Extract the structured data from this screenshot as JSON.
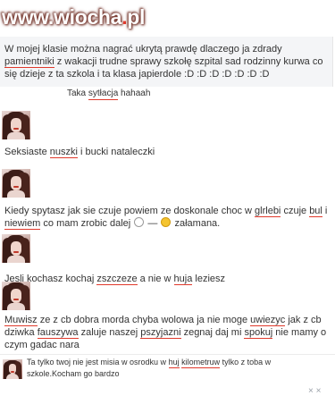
{
  "watermark": {
    "prefix": "www.",
    "brand": "wiocha",
    "dot": ".",
    "suffix": "pl"
  },
  "messages": [
    {
      "text_a": "W mojej klasie można nagrać ukrytą prawdę dlaczego ja zdrady ",
      "sp_a": "pamientniki",
      "text_b": " z wakacji trudne sprawy szkołę szpital sad rodzinny kurwa co się dzieje z ta szkola i ta klasa japierdole :D :D :D :D :D :D :D"
    },
    {
      "text_a": "Taka ",
      "sp_a": "sytłacja",
      "text_b": " hahaah"
    },
    {
      "text_a": "Seksiaste ",
      "sp_a": "nuszki",
      "text_b": " i bucki nataleczki"
    },
    {
      "text_a": "Kiedy spytasz jak sie czuje powiem ze doskonale choc w ",
      "sp_a": "glrlebi",
      "text_b": " czuje ",
      "sp_b": "bul",
      "text_c": " i ",
      "sp_c": "niewiem",
      "text_d": " co mam zrobic dalej ",
      "dash": " — ",
      "text_e": " załamana."
    },
    {
      "text_a": "Jesli kochasz kochaj ",
      "sp_a": "zszczeze",
      "text_b": " a nie w ",
      "sp_b": "huja",
      "text_c": " leziesz"
    },
    {
      "text_a": "Muwisz",
      "text_b": " ze z cb dobra morda chyba wolowa ja nie moge ",
      "sp_b": "uwiezyc",
      "text_c": " jak z cb dziwka ",
      "sp_c": "fauszywa",
      "text_d": " zaluje naszej ",
      "sp_d": "pszyjazni",
      "text_e": " zegnaj daj mi ",
      "sp_e": "spokuj",
      "text_f": " nie mamy o czym gadac nara"
    },
    {
      "text_a": "Ta tylko twoj nie jest misia w osrodku w ",
      "sp_a": "huj",
      "text_b": " ",
      "sp_b": "kilometruw",
      "text_c": " tylko z toba w szkole.Kocham go bardzo"
    }
  ],
  "footer": {
    "close": "× ×"
  },
  "colors": {
    "spellcheck": "#e0392b",
    "highlight": "#f4f5f7",
    "text": "#333333"
  }
}
